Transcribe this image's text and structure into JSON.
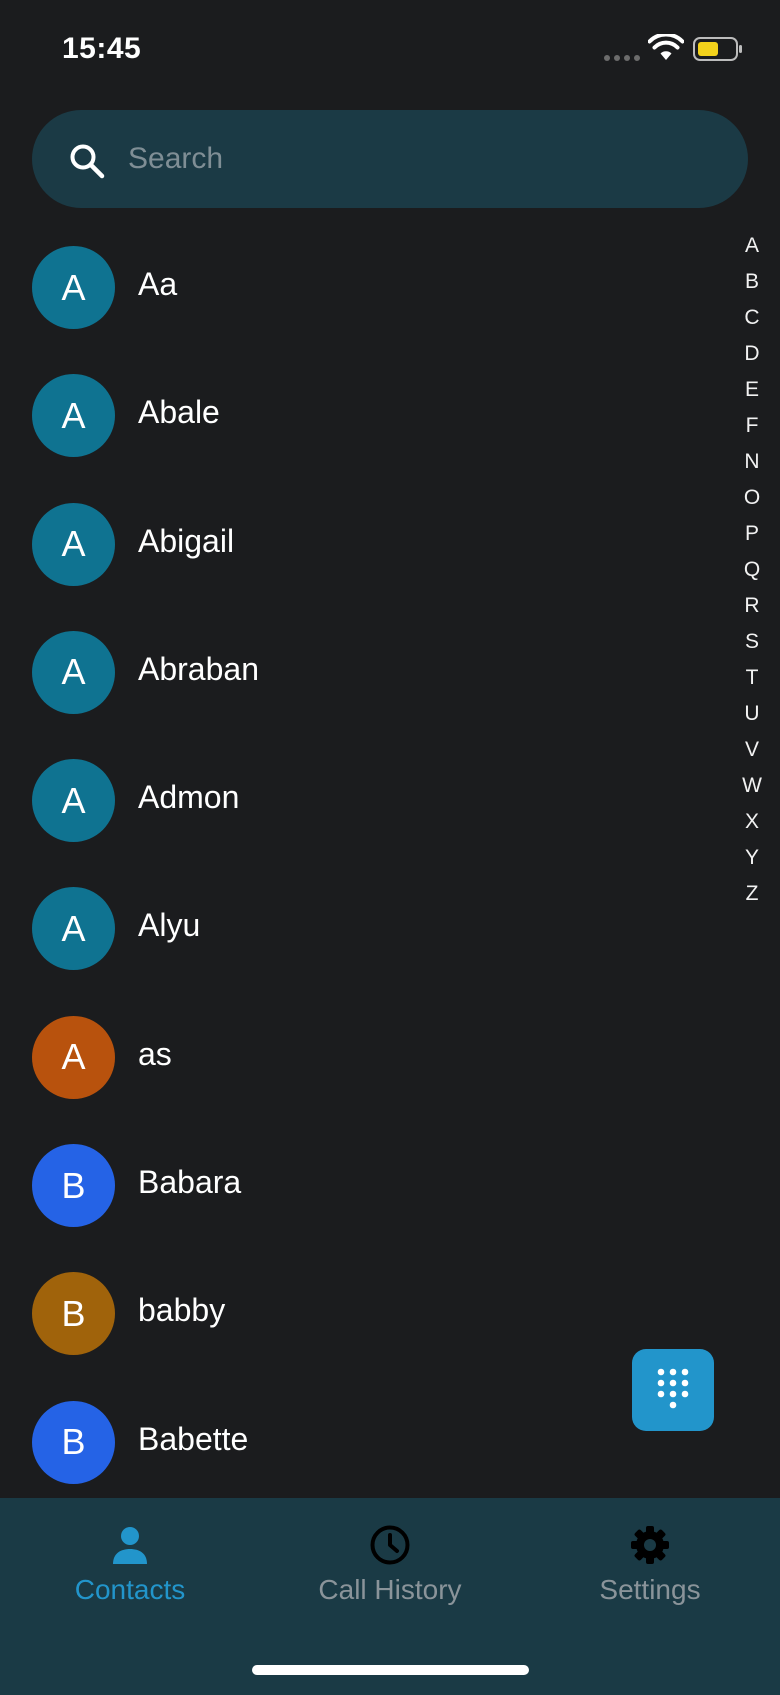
{
  "status_bar": {
    "time": "15:45"
  },
  "search": {
    "placeholder": "Search"
  },
  "contacts": [
    {
      "initial": "A",
      "name": "Aa",
      "color": "#0f7391"
    },
    {
      "initial": "A",
      "name": "Abale",
      "color": "#0f7391"
    },
    {
      "initial": "A",
      "name": "Abigail",
      "color": "#0f7391"
    },
    {
      "initial": "A",
      "name": "Abraban",
      "color": "#0f7391"
    },
    {
      "initial": "A",
      "name": "Admon",
      "color": "#0f7391"
    },
    {
      "initial": "A",
      "name": "Alyu",
      "color": "#0f7391"
    },
    {
      "initial": "A",
      "name": "as",
      "color": "#b8520d"
    },
    {
      "initial": "B",
      "name": "Babara",
      "color": "#2563e6"
    },
    {
      "initial": "B",
      "name": "babby",
      "color": "#a0630b"
    },
    {
      "initial": "B",
      "name": "Babette",
      "color": "#2563e6"
    }
  ],
  "alphabet_index": [
    "A",
    "B",
    "C",
    "D",
    "E",
    "F",
    "N",
    "O",
    "P",
    "Q",
    "R",
    "S",
    "T",
    "U",
    "V",
    "W",
    "X",
    "Y",
    "Z"
  ],
  "keypad_button": {
    "icon": "dialpad-icon"
  },
  "tab_bar": {
    "tabs": [
      {
        "label": "Contacts",
        "icon": "person-icon",
        "active": true
      },
      {
        "label": "Call History",
        "icon": "clock-icon",
        "active": false
      },
      {
        "label": "Settings",
        "icon": "gear-icon",
        "active": false
      }
    ]
  },
  "colors": {
    "background": "#1b1c1e",
    "search_bg": "#1b3a45",
    "tab_bar_bg": "#1a3a45",
    "accent": "#2295cb",
    "inactive_tab": "#8a949a"
  }
}
